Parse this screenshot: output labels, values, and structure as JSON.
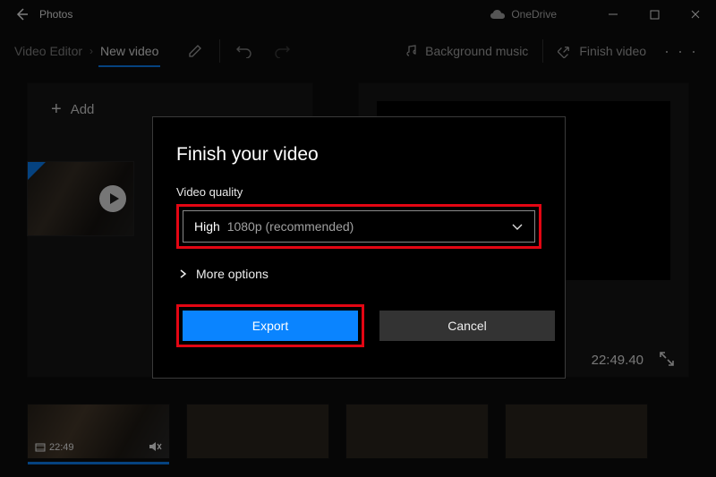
{
  "titlebar": {
    "app_title": "Photos",
    "cloud_service": "OneDrive"
  },
  "toolbar": {
    "breadcrumb_root": "Video Editor",
    "breadcrumb_current": "New video",
    "background_music": "Background music",
    "finish_video": "Finish video"
  },
  "project": {
    "add_label": "Add"
  },
  "preview": {
    "timecode": "22:49.40"
  },
  "storyboard": {
    "clip_duration": "22:49"
  },
  "dialog": {
    "title": "Finish your video",
    "quality_label": "Video quality",
    "quality_strong": "High",
    "quality_rest": "1080p (recommended)",
    "more_options": "More options",
    "export_label": "Export",
    "cancel_label": "Cancel"
  }
}
